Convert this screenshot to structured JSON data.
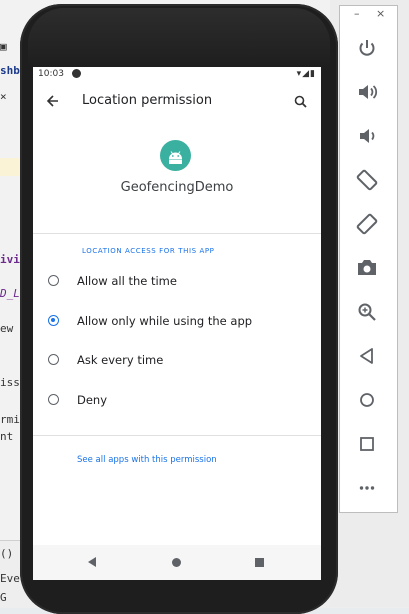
{
  "ide": {
    "fragments": [
      "shb",
      "ivi",
      "D_L",
      "ew ",
      "iss",
      "rmi",
      "nt =",
      "()",
      "Eve",
      "G"
    ]
  },
  "status_bar": {
    "time": "10:03",
    "icons": "▾◢▮"
  },
  "app_bar": {
    "back_icon": "arrow-back-icon",
    "title": "Location permission",
    "search_icon": "search-icon"
  },
  "app": {
    "name": "GeofencingDemo",
    "icon_color": "#3ab0a0"
  },
  "permission": {
    "section_header": "LOCATION ACCESS FOR THIS APP",
    "options": [
      {
        "label": "Allow all the time",
        "selected": false
      },
      {
        "label": "Allow only while using the app",
        "selected": true
      },
      {
        "label": "Ask every time",
        "selected": false
      },
      {
        "label": "Deny",
        "selected": false
      }
    ],
    "see_all_link": "See all apps with this permission"
  },
  "emulator_panel": {
    "minimize": "–",
    "close": "×",
    "buttons": [
      "power-icon",
      "volume-up-icon",
      "volume-down-icon",
      "rotate-left-icon",
      "rotate-right-icon",
      "camera-icon",
      "zoom-icon",
      "back-icon",
      "home-icon",
      "overview-icon",
      "more-icon"
    ]
  },
  "colors": {
    "accent": "#1a73e8",
    "text": "#202124"
  }
}
